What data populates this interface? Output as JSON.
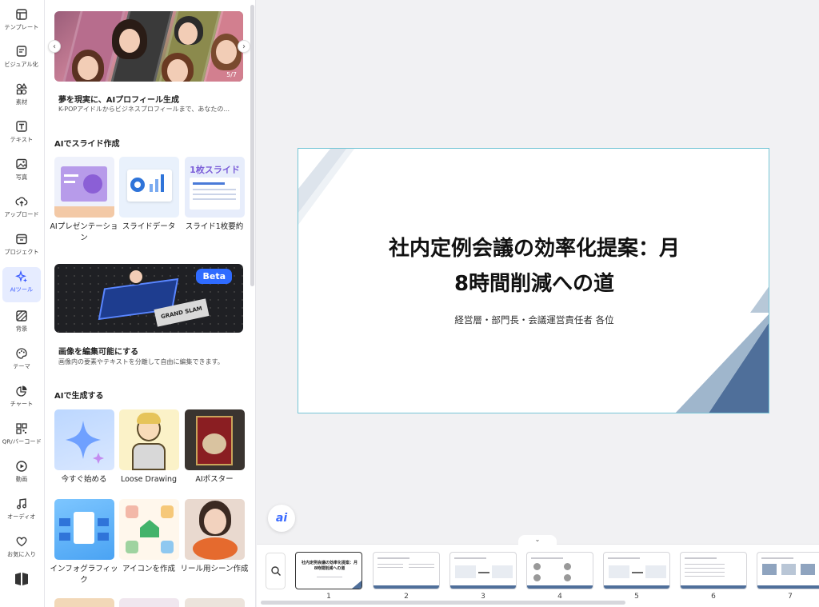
{
  "rail": {
    "items": [
      {
        "label": "テンプレート",
        "icon": "template-icon"
      },
      {
        "label": "ビジュアル化",
        "icon": "visualize-icon"
      },
      {
        "label": "素材",
        "icon": "elements-icon"
      },
      {
        "label": "テキスト",
        "icon": "text-icon"
      },
      {
        "label": "写真",
        "icon": "photo-icon"
      },
      {
        "label": "アップロード",
        "icon": "upload-icon"
      },
      {
        "label": "プロジェクト",
        "icon": "project-icon"
      },
      {
        "label": "AIツール",
        "icon": "ai-tool-icon"
      },
      {
        "label": "背景",
        "icon": "background-icon"
      },
      {
        "label": "テーマ",
        "icon": "theme-icon"
      },
      {
        "label": "チャート",
        "icon": "chart-icon"
      },
      {
        "label": "QR/バーコード",
        "icon": "qr-icon"
      },
      {
        "label": "動画",
        "icon": "video-icon"
      },
      {
        "label": "オーディオ",
        "icon": "audio-icon"
      },
      {
        "label": "お気に入り",
        "icon": "heart-icon"
      }
    ],
    "active_index": 7
  },
  "panel": {
    "banner": {
      "count": "5/7",
      "title": "夢を現実に、AIプロフィール生成",
      "subtitle": "K-POPアイドルからビジネスプロフィールまで、あなたの..."
    },
    "section_slides": {
      "title": "AIでスライド作成",
      "cards": [
        {
          "label": "AIプレゼンテーション"
        },
        {
          "label": "スライドデータ"
        },
        {
          "label": "スライド1枚要約",
          "thumb_text": "1枚スライド"
        }
      ]
    },
    "editable_image": {
      "badge": "Beta",
      "title": "画像を編集可能にする",
      "subtitle": "画像内の要素やテキストを分離して自由に編集できます。",
      "art_text": "GRAND SLAM"
    },
    "section_generate": {
      "title": "AIで生成する",
      "cards": [
        {
          "label": "今すぐ始める"
        },
        {
          "label": "Loose Drawing"
        },
        {
          "label": "AIポスター"
        },
        {
          "label": "インフォグラフィック"
        },
        {
          "label": "アイコンを作成"
        },
        {
          "label": "リール用シーン作成"
        }
      ]
    }
  },
  "slide": {
    "title_line1": "社内定例会議の効率化提案：月",
    "title_line2": "8時間削減への道",
    "subtitle": "経営層・部門長・会議運営責任者 各位"
  },
  "ai_button": "ai",
  "filmstrip": {
    "toggle": "⌄",
    "thumbs": [
      {
        "num": "1",
        "text": "社内定例会議の効率化提案：月8時間削減への道"
      },
      {
        "num": "2"
      },
      {
        "num": "3"
      },
      {
        "num": "4"
      },
      {
        "num": "5"
      },
      {
        "num": "6"
      },
      {
        "num": "7"
      }
    ],
    "selected": "1"
  },
  "colors": {
    "accent": "#3b5bff",
    "slide_border": "#77c6d6",
    "slide_blue": "#4f6f9a"
  }
}
